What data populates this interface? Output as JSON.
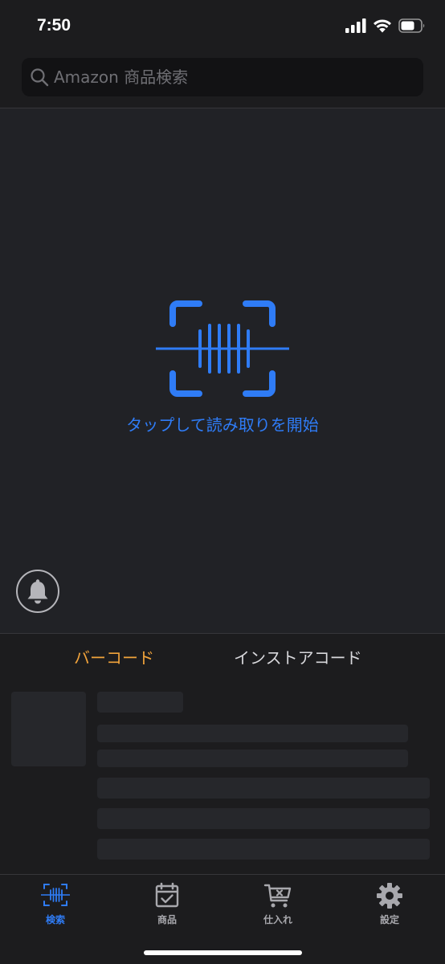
{
  "status_bar": {
    "time": "7:50"
  },
  "search": {
    "placeholder": "Amazon 商品検索",
    "value": ""
  },
  "scanner": {
    "tap_label": "タップして読み取りを開始",
    "accent_color": "#2f7cf6"
  },
  "segments": [
    {
      "label": "バーコード",
      "selected": true
    },
    {
      "label": "インストアコード",
      "selected": false
    }
  ],
  "tab_bar": {
    "tabs": [
      {
        "label": "検索",
        "icon": "barcode-scan-icon",
        "active": true
      },
      {
        "label": "商品",
        "icon": "calendar-check-icon",
        "active": false
      },
      {
        "label": "仕入れ",
        "icon": "cart-x-icon",
        "active": false
      },
      {
        "label": "設定",
        "icon": "gear-icon",
        "active": false
      }
    ]
  },
  "colors": {
    "background": "#1c1c1e",
    "scanner_background": "#212226",
    "accent_blue": "#2f7cf6",
    "accent_orange": "#f1a33b"
  }
}
